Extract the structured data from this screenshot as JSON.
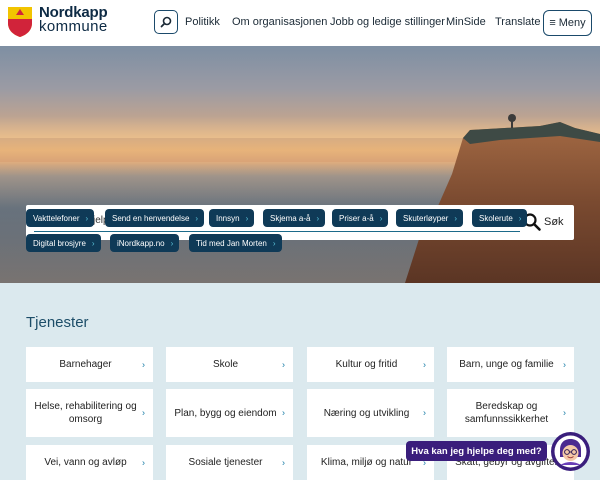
{
  "logo": {
    "name": "Nordkapp",
    "sub": "kommune"
  },
  "header": {
    "search_icon": "search-icon",
    "nav": [
      "Politikk",
      "Om organisasjonen",
      "Jobb og ledige stillinger",
      "MinSide",
      "Translate"
    ],
    "menu_label": "Meny"
  },
  "hero": {
    "search_placeholder": "Hva kan vi hjelpe deg med?",
    "search_button": "Søk",
    "quick_links": [
      "Vakttelefoner",
      "Send en henvendelse",
      "Innsyn",
      "Skjema a-å",
      "Priser a-å",
      "Skuterløyper",
      "Skolerute",
      "Digital brosjyre",
      "iNordkapp.no",
      "Tid med Jan Morten"
    ]
  },
  "services": {
    "title": "Tjenester",
    "cards": [
      "Barnehager",
      "Skole",
      "Kultur og fritid",
      "Barn, unge og familie",
      "Helse, rehabilitering og omsorg",
      "Plan, bygg og eiendom",
      "Næring og utvikling",
      "Beredskap og samfunnssikkerhet",
      "Vei, vann og avløp",
      "Sosiale tjenester",
      "Klima, miljø og natur",
      "Skatt, gebyr og avgifter"
    ]
  },
  "chat": {
    "label": "Hva kan jeg hjelpe deg med?"
  },
  "colors": {
    "navy": "#0f3a57",
    "accent": "#1b7ea8",
    "chat": "#3a1e7c",
    "section_bg": "#dbe9ee"
  }
}
